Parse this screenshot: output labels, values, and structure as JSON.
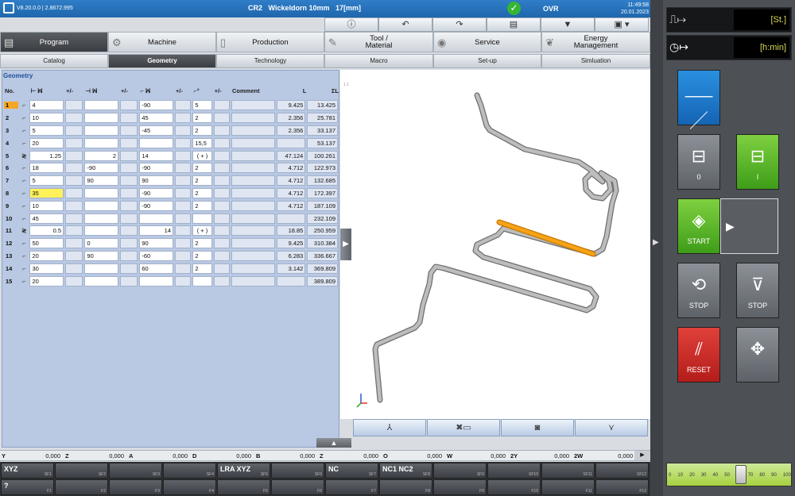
{
  "titlebar": {
    "version": "V8.20.0.0 | 2.8672.995",
    "machine": "CR2",
    "job": "Wickeldorn 10mm",
    "dimension": "17[mm]",
    "ovr": "OVR",
    "time": "11:49:58",
    "date": "20.01.2023"
  },
  "tabs": [
    {
      "label": "Program",
      "icon": "document-icon"
    },
    {
      "label": "Machine",
      "icon": "gears-icon"
    },
    {
      "label": "Production",
      "icon": "page-icon"
    },
    {
      "label": "Tool /\nMaterial",
      "icon": "wrench-icon"
    },
    {
      "label": "Service",
      "icon": "eye-icon"
    },
    {
      "label": "Energy\nManagement",
      "icon": "leaf-icon"
    }
  ],
  "subtabs": [
    "Catalog",
    "Geometry",
    "Technology",
    "Macro",
    "Set-up",
    "Simluation"
  ],
  "geometry": {
    "title": "Geometry",
    "headers": {
      "no": "No.",
      "pm1": "+/-",
      "pm2": "+/-",
      "pm3": "+/-",
      "pm4": "+/-",
      "comment": "Comment",
      "l": "L",
      "sl": "ΣL"
    },
    "rows": [
      {
        "no": "1",
        "type": "bend",
        "l": "4",
        "r": "",
        "a": "-90",
        "rot": "5",
        "L": "9.425",
        "sum": "13.425"
      },
      {
        "no": "2",
        "type": "bend",
        "l": "10",
        "r": "",
        "a": "45",
        "rot": "2",
        "L": "2.356",
        "sum": "25.781"
      },
      {
        "no": "3",
        "type": "bend",
        "l": "5",
        "r": "",
        "a": "-45",
        "rot": "2",
        "L": "2.356",
        "sum": "33.137"
      },
      {
        "no": "4",
        "type": "bend",
        "l": "20",
        "r": "",
        "a": "",
        "rot": "15,5",
        "L": "",
        "sum": "53.137"
      },
      {
        "no": "5",
        "type": "coil",
        "l": "1.25",
        "r": "2",
        "a": "14",
        "rot": "( + )",
        "L": "47.124",
        "sum": "100.261"
      },
      {
        "no": "6",
        "type": "bend",
        "l": "18",
        "r": "-90",
        "a": "-90",
        "rot": "2",
        "L": "4.712",
        "sum": "122.973"
      },
      {
        "no": "7",
        "type": "bend",
        "l": "5",
        "r": "90",
        "a": "90",
        "rot": "2",
        "L": "4.712",
        "sum": "132.685"
      },
      {
        "no": "8",
        "type": "bend",
        "l": "35",
        "r": "",
        "a": "-90",
        "rot": "2",
        "L": "4.712",
        "sum": "172.397"
      },
      {
        "no": "9",
        "type": "bend",
        "l": "10",
        "r": "",
        "a": "-90",
        "rot": "2",
        "L": "4.712",
        "sum": "187.109"
      },
      {
        "no": "10",
        "type": "bend",
        "l": "45",
        "r": "",
        "a": "",
        "rot": "",
        "L": "",
        "sum": "232.109"
      },
      {
        "no": "11",
        "type": "coil",
        "l": "0.5",
        "r": "",
        "a": "14",
        "rot": "( + )",
        "L": "18.85",
        "sum": "250.959"
      },
      {
        "no": "12",
        "type": "bend",
        "l": "50",
        "r": "0",
        "a": "90",
        "rot": "2",
        "L": "9.425",
        "sum": "310.384"
      },
      {
        "no": "13",
        "type": "bend",
        "l": "20",
        "r": "90",
        "a": "-60",
        "rot": "2",
        "L": "6.283",
        "sum": "336.667"
      },
      {
        "no": "14",
        "type": "bend",
        "l": "30",
        "r": "",
        "a": "60",
        "rot": "2",
        "L": "3.142",
        "sum": "369.809"
      },
      {
        "no": "15",
        "type": "bend",
        "l": "20",
        "r": "",
        "a": "",
        "rot": "",
        "L": "",
        "sum": "389.809"
      }
    ]
  },
  "axes": [
    {
      "name": "Y",
      "value": "0,000"
    },
    {
      "name": "Z",
      "value": "0,000"
    },
    {
      "name": "A",
      "value": "0,000"
    },
    {
      "name": "D",
      "value": "0,000"
    },
    {
      "name": "B",
      "value": "0,000"
    },
    {
      "name": "Z",
      "value": "0,000"
    },
    {
      "name": "O",
      "value": "0,000"
    },
    {
      "name": "W",
      "value": "0,000"
    },
    {
      "name": "2Y",
      "value": "0,000"
    },
    {
      "name": "2W",
      "value": "0,000"
    }
  ],
  "softkeys_top": [
    {
      "label": "XYZ",
      "fk": "SF1"
    },
    {
      "label": "",
      "fk": "SF2"
    },
    {
      "label": "",
      "fk": "SF3"
    },
    {
      "label": "",
      "fk": "SF4"
    },
    {
      "label": "LRA XYZ",
      "fk": "SF5"
    },
    {
      "label": "",
      "fk": "SF6"
    },
    {
      "label": "NC",
      "fk": "SF7"
    },
    {
      "label": "NC1 NC2",
      "fk": "SF8"
    },
    {
      "label": "",
      "fk": "SF9"
    },
    {
      "label": "",
      "fk": "SF10"
    },
    {
      "label": "",
      "fk": "SF11"
    },
    {
      "label": "",
      "fk": "SF12"
    }
  ],
  "softkeys_bottom": [
    {
      "label": "?",
      "fk": "F1"
    },
    {
      "label": "",
      "fk": "F2"
    },
    {
      "label": "",
      "fk": "F3"
    },
    {
      "label": "",
      "fk": "F4"
    },
    {
      "label": "",
      "fk": "F5"
    },
    {
      "label": "",
      "fk": "F6"
    },
    {
      "label": "",
      "fk": "F7"
    },
    {
      "label": "",
      "fk": "F8"
    },
    {
      "label": "",
      "fk": "F9"
    },
    {
      "label": "",
      "fk": "F10"
    },
    {
      "label": "",
      "fk": "F11"
    },
    {
      "label": "",
      "fk": "F12"
    }
  ],
  "right": {
    "pieces_unit": "[St.]",
    "time_unit": "[h:min]",
    "drive_off": "0",
    "drive_on": "I",
    "start": "START",
    "stop_cycle": "STOP",
    "stop": "STOP",
    "reset": "RESET",
    "override_ticks": [
      "0",
      "10",
      "20",
      "30",
      "40",
      "50",
      "60",
      "70",
      "80",
      "90",
      "100"
    ],
    "override_percent": 60
  }
}
